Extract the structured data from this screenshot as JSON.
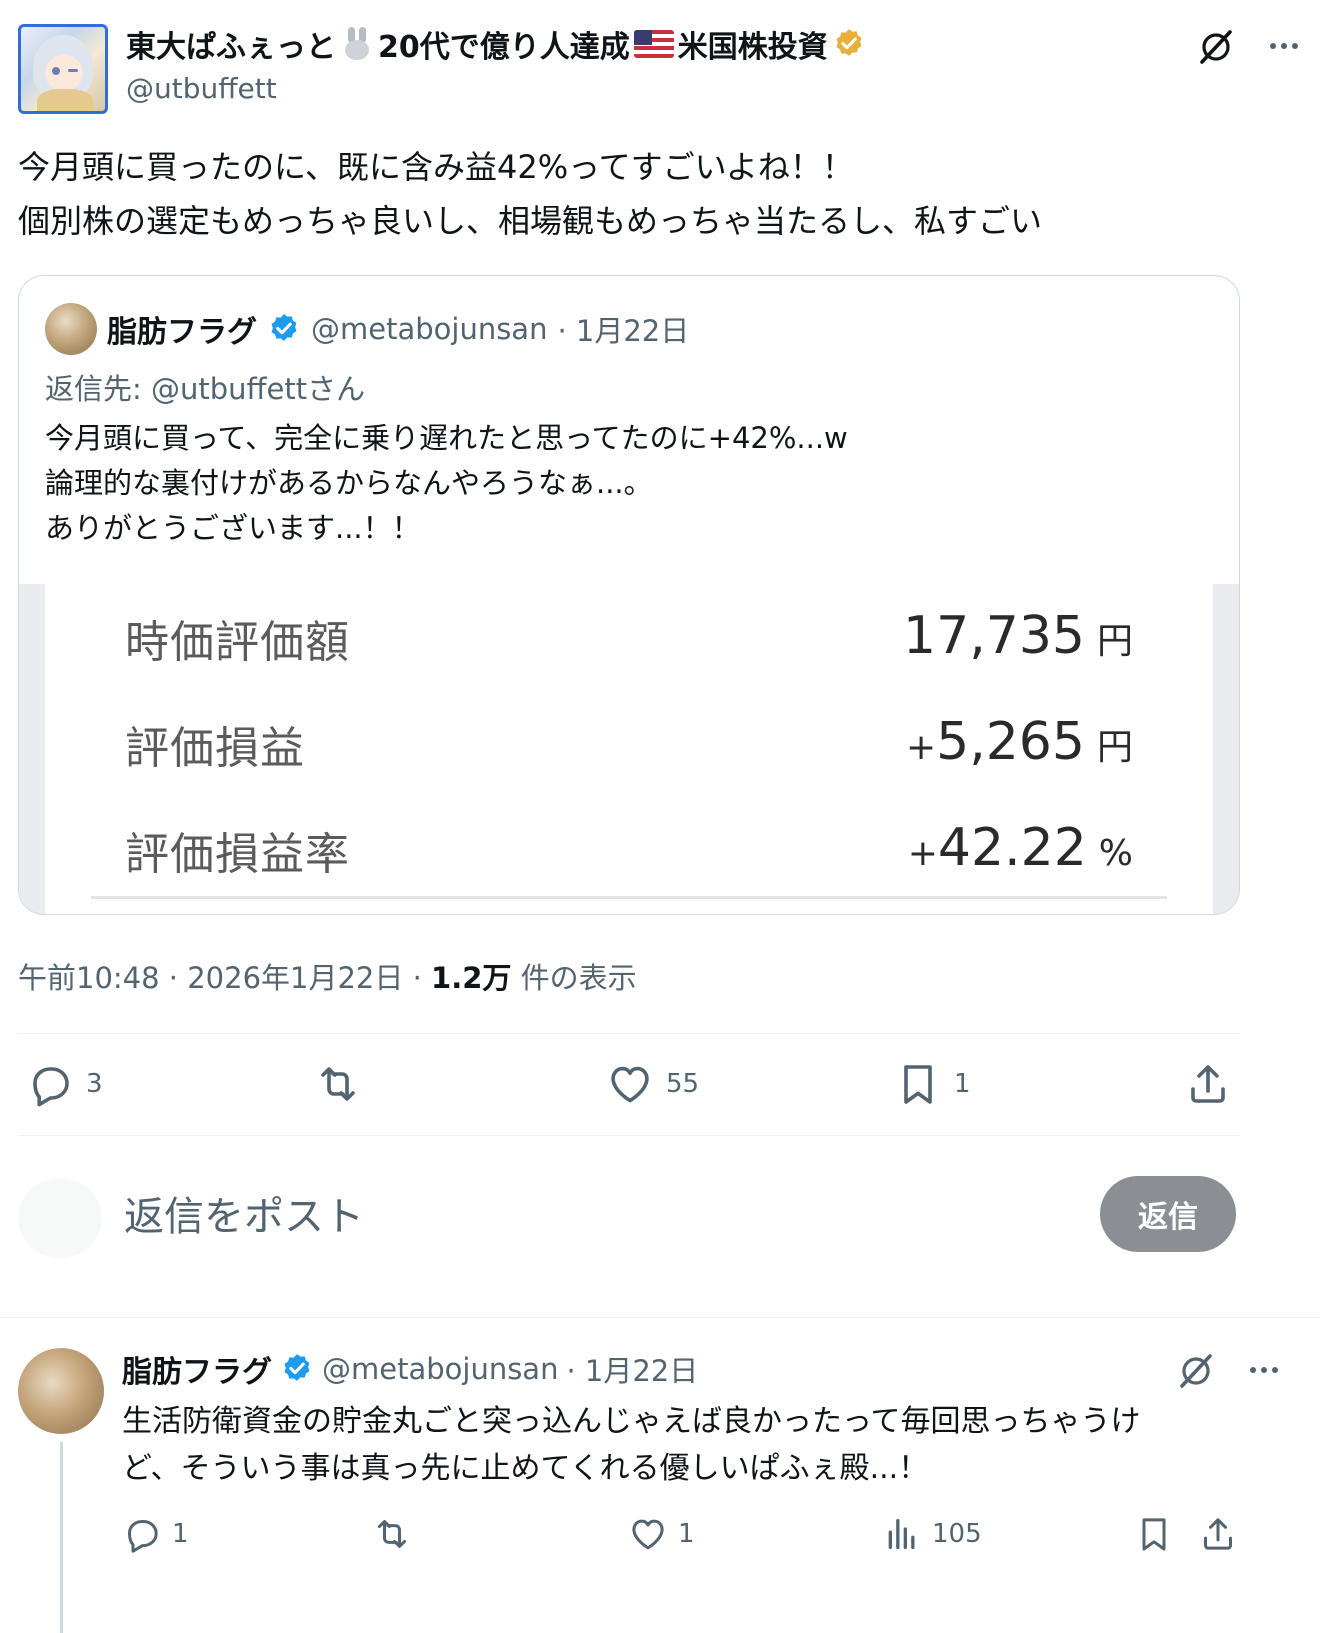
{
  "main_tweet": {
    "author_name": "東大ぱふぇっと",
    "author_name_mid": "20代で億り人達成",
    "author_name_end": "米国株投資",
    "handle": "@utbuffett",
    "text": "今月頭に買ったのに、既に含み益42%ってすごいよね！！\n個別株の選定もめっちゃ良いし、相場観もめっちゃ当たるし、私すごい",
    "quote": {
      "author_name": "脂肪フラグ",
      "handle": "@metabojunsan",
      "date": "· 1月22日",
      "reply_to": "返信先: @utbuffettさん",
      "text": "今月頭に買って、完全に乗り遅れたと思ってたのに+42%...w\n論理的な裏付けがあるからなんやろうなぁ...。\nありがとうございます...！！",
      "image": {
        "rows": [
          {
            "label": "時価評価額",
            "sign": "",
            "value": "17,735",
            "unit": "円"
          },
          {
            "label": "評価損益",
            "sign": "+",
            "value": "5,265",
            "unit": "円"
          },
          {
            "label": "評価損益率",
            "sign": "+",
            "value": "42.22",
            "unit": "%"
          }
        ]
      }
    },
    "meta": {
      "time_date": "午前10:48 · 2026年1月22日 · ",
      "views_count": "1.2万",
      "views_label": " 件の表示"
    },
    "actions": {
      "replies": "3",
      "retweets": "",
      "likes": "55",
      "bookmarks": "1"
    }
  },
  "composer": {
    "placeholder": "返信をポスト",
    "button_label": "返信"
  },
  "reply_tweet": {
    "author_name": "脂肪フラグ",
    "handle": "@metabojunsan",
    "date": "· 1月22日",
    "text": "生活防衛資金の貯金丸ごと突っ込んじゃえば良かったって毎回思っちゃうけ\nど、そういう事は真っ先に止めてくれる優しいぱふぇ殿...！",
    "actions": {
      "replies": "1",
      "retweets": "",
      "likes": "1",
      "views": "105"
    }
  },
  "colors": {
    "secondary_text": "#536471",
    "verified_blue": "#1d9bf0",
    "verified_gold": "#e8b03a",
    "reply_button_bg": "#8b8f93",
    "border": "#cfd9de"
  }
}
